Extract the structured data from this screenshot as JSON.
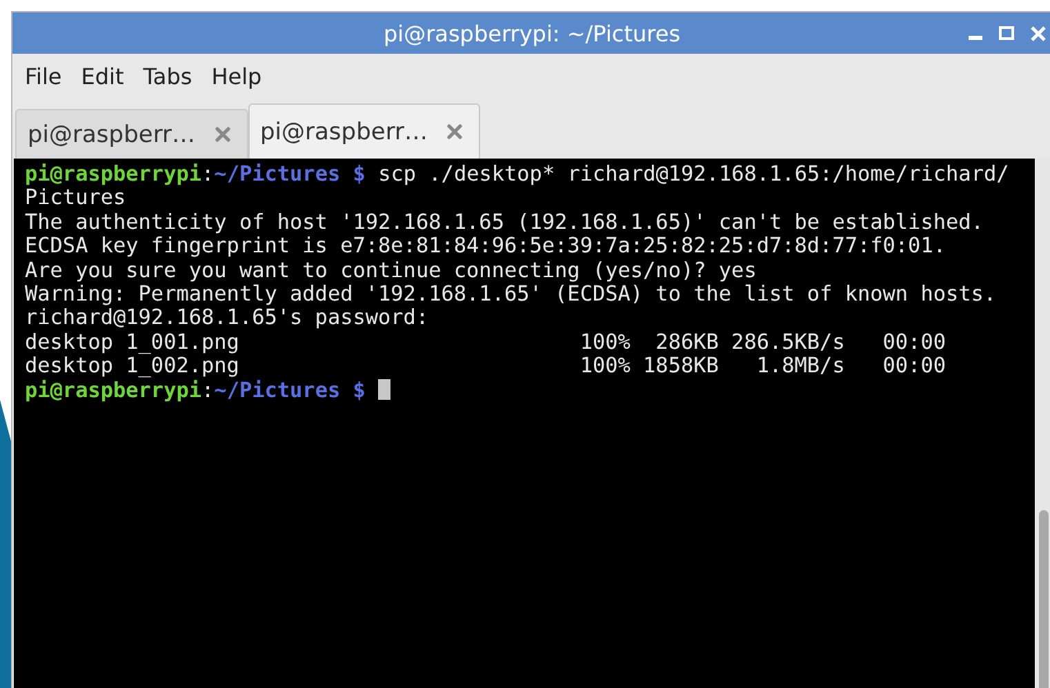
{
  "window": {
    "title": "pi@raspberrypi: ~/Pictures"
  },
  "menu": [
    "File",
    "Edit",
    "Tabs",
    "Help"
  ],
  "tabs": [
    {
      "label": "pi@raspberr…",
      "selected": false
    },
    {
      "label": "pi@raspberr…",
      "selected": true
    }
  ],
  "terminal": {
    "cursor": true,
    "lines": [
      {
        "kind": "prompt",
        "user": "pi@raspberrypi",
        "separator": ":",
        "path": "~/Pictures",
        "symbol": "$",
        "command": "scp ./desktop* richard@192.168.1.65:/home/richard/"
      },
      {
        "kind": "output",
        "text": "Pictures"
      },
      {
        "kind": "output",
        "text": "The authenticity of host '192.168.1.65 (192.168.1.65)' can't be established."
      },
      {
        "kind": "output",
        "text": "ECDSA key fingerprint is e7:8e:81:84:96:5e:39:7a:25:82:25:d7:8d:77:f0:01."
      },
      {
        "kind": "output",
        "text": "Are you sure you want to continue connecting (yes/no)? yes"
      },
      {
        "kind": "output",
        "text": "Warning: Permanently added '192.168.1.65' (ECDSA) to the list of known hosts."
      },
      {
        "kind": "output",
        "text": "richard@192.168.1.65's password:"
      },
      {
        "kind": "output",
        "text": "desktop 1_001.png                           100%  286KB 286.5KB/s   00:00"
      },
      {
        "kind": "output",
        "text": "desktop 1_002.png                           100% 1858KB   1.8MB/s   00:00"
      },
      {
        "kind": "prompt",
        "user": "pi@raspberrypi",
        "separator": ":",
        "path": "~/Pictures",
        "symbol": "$"
      }
    ]
  }
}
